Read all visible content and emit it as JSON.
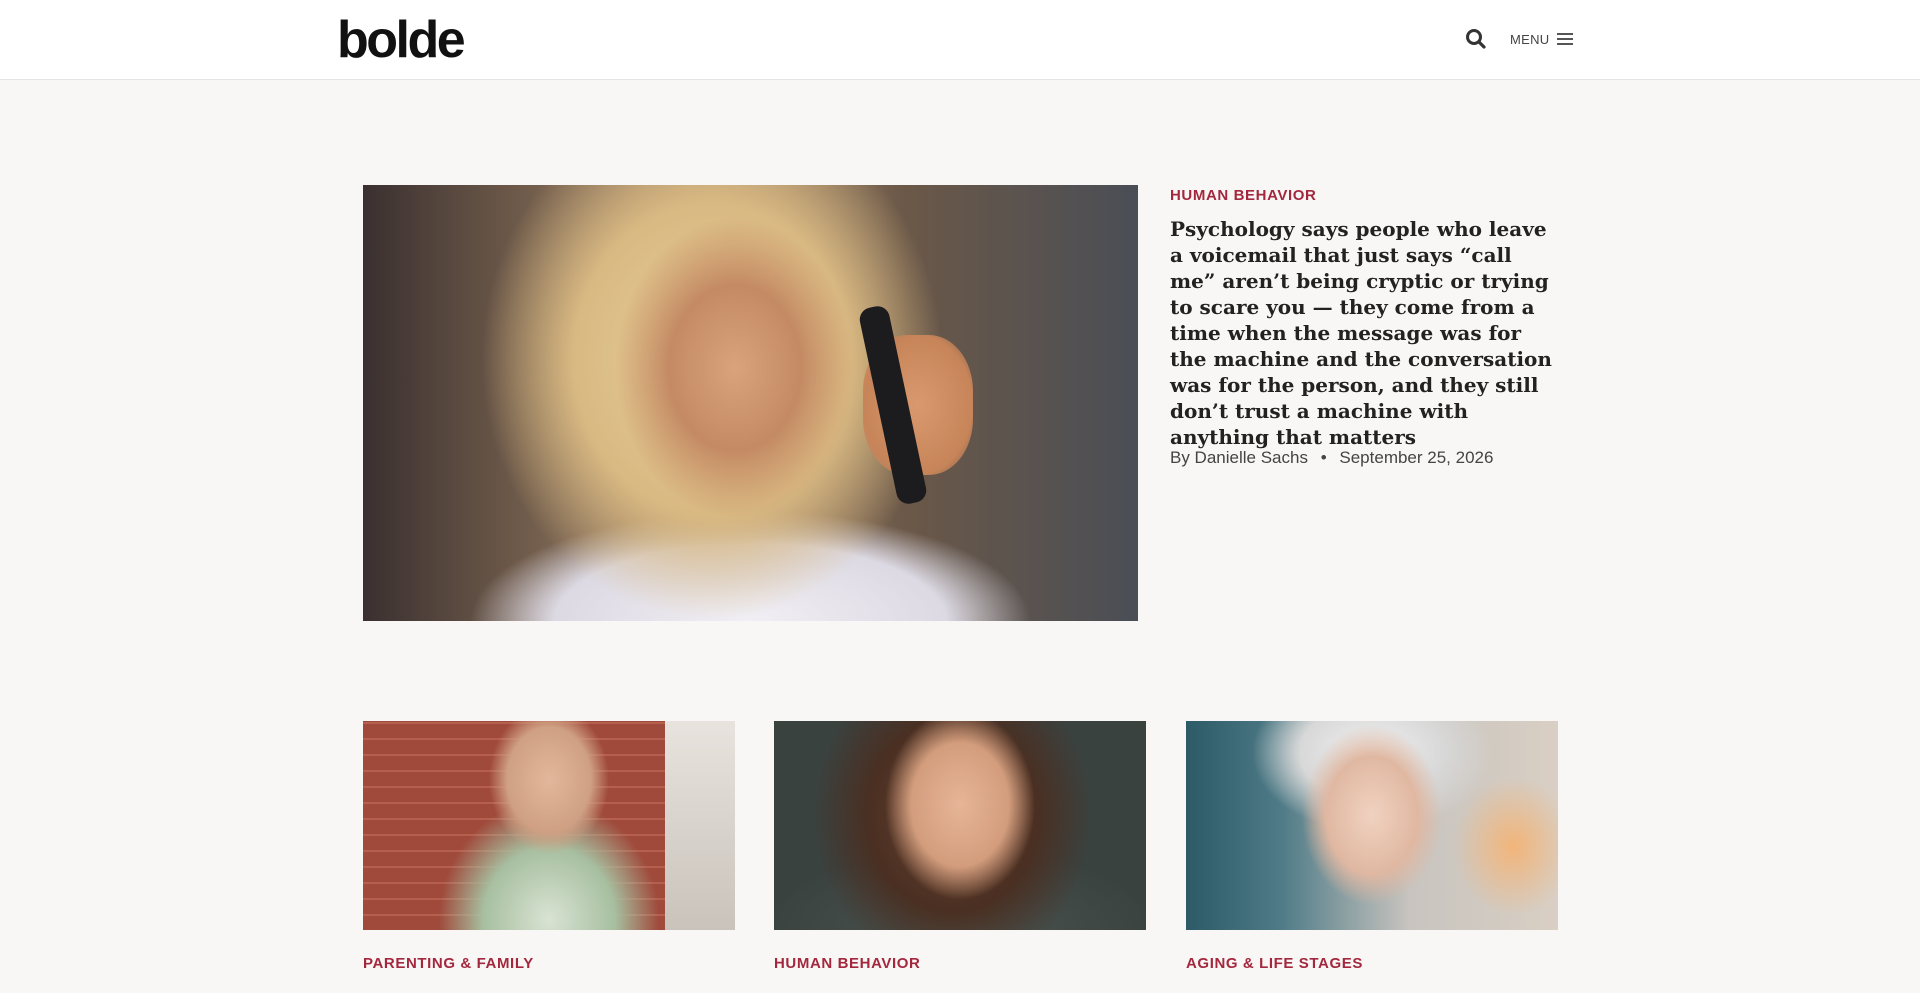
{
  "header": {
    "logo": "bolde",
    "search_icon": "search-icon",
    "menu_label": "MENU",
    "menu_icon": "hamburger-icon"
  },
  "hero": {
    "category": "HUMAN BEHAVIOR",
    "title": "Psychology says people who leave a voicemail that just says “call me” aren’t being cryptic or trying to scare you — they come from a time when the message was for the machine and the conversation was for the person, and they still don’t trust a machine with anything that matters",
    "author": "By Danielle Sachs",
    "separator": "•",
    "date": "September 25, 2026"
  },
  "cards": [
    {
      "category": "PARENTING & FAMILY",
      "title": ""
    },
    {
      "category": "HUMAN BEHAVIOR",
      "title": ""
    },
    {
      "category": "AGING & LIFE STAGES",
      "title": ""
    }
  ],
  "colors": {
    "accent": "#a3283e",
    "background": "#f9f7f6",
    "header_bg": "#ffffff"
  }
}
